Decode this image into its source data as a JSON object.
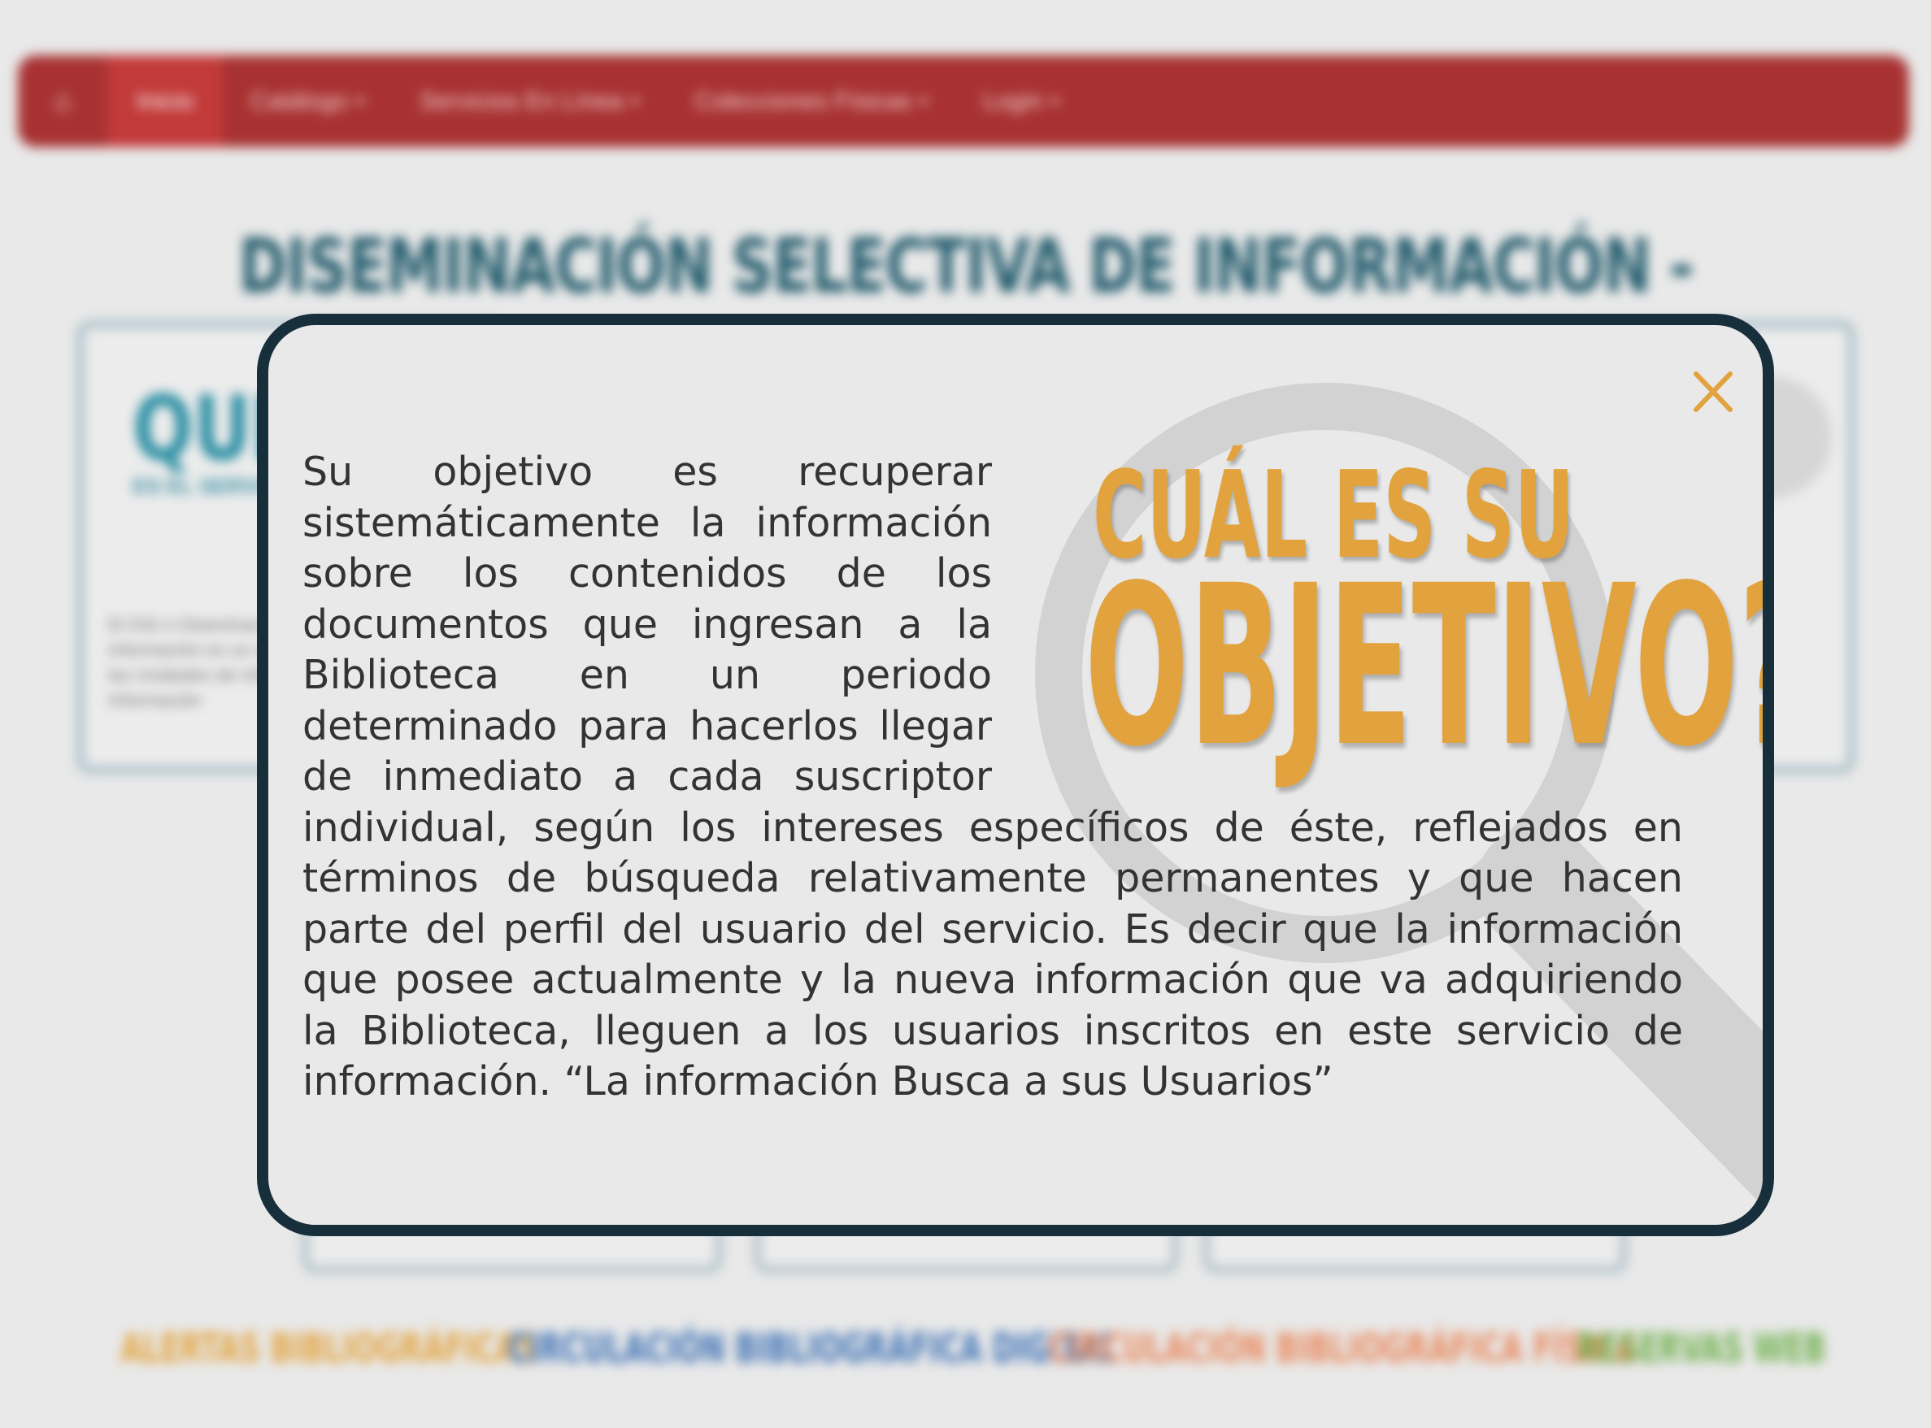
{
  "navbar": {
    "items": [
      {
        "label": "Inicio",
        "active": true
      },
      {
        "label": "Catálogo",
        "dropdown": true
      },
      {
        "label": "Servicios En Línea",
        "dropdown": true
      },
      {
        "label": "Colecciones Físicas",
        "dropdown": true
      },
      {
        "label": "Login",
        "dropdown": true
      }
    ],
    "color": "#a83232"
  },
  "page": {
    "title": "DISEMINACIÓN SELECTIVA DE INFORMACIÓN - DSI:",
    "title_color": "#255d6e",
    "left_card": {
      "heading": "QUE",
      "subheading": "ES EL SERVICIO",
      "text": "El DSI o Diseminación Selectiva de Información es un servicio especializado para las Unidades de Información y Centros de Información"
    },
    "services": [
      {
        "label": "ALERTAS BIBLIOGRÁFICAS",
        "color": "#e2a23d"
      },
      {
        "label": "CIRCULACIÓN BIBLIOGRÁFICA DIGITAL",
        "color": "#3f72b6"
      },
      {
        "label": "CIRCULACIÓN BIBLIOGRÁFICA FÍSICA",
        "color": "#e8875a"
      },
      {
        "label": "RESERVAS WEB",
        "color": "#6fb04c"
      }
    ]
  },
  "modal": {
    "heading_line1": "CUÁL ES SU",
    "heading_line2": "OBJETIVO?",
    "heading_color": "#e2a23d",
    "border_color": "#172e3b",
    "close_icon": "close-x",
    "close_color": "#e2a23d",
    "body": "Su objetivo es recuperar sistemáticamente la información sobre los contenidos de los documentos que ingresan a la Biblioteca en un periodo determinado para hacerlos llegar de inmediato a cada suscriptor individual, según los intereses específicos de éste, reflejados en términos de búsqueda relativamente permanentes y que hacen parte del perfil del usuario del servicio. Es decir que la información que posee actualmente y la nueva información que va adquiriendo la Biblioteca, lleguen a los usuarios inscritos en este servicio de información.  “La información Busca a sus Usuarios”"
  }
}
